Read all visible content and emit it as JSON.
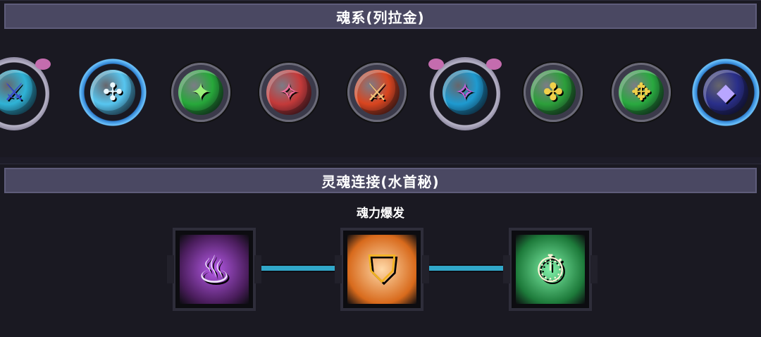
{
  "soul_section": {
    "title": "魂系(列拉金)",
    "items": [
      {
        "name": "soul-slot-1",
        "frame": "ornate",
        "orb_color": "#2fb3d6",
        "glyph": "⚔",
        "glyph_color": "#3a4ad0"
      },
      {
        "name": "soul-slot-2",
        "frame": "blue",
        "orb_color": "#57c6f0",
        "glyph": "✣",
        "glyph_color": "#eaf8ff"
      },
      {
        "name": "soul-slot-3",
        "frame": "plain",
        "orb_color": "#27a83a",
        "glyph": "✦",
        "glyph_color": "#9af07a"
      },
      {
        "name": "soul-slot-4",
        "frame": "plain",
        "orb_color": "#c43a3a",
        "glyph": "✧",
        "glyph_color": "#ff6fa3"
      },
      {
        "name": "soul-slot-5",
        "frame": "plain",
        "orb_color": "#d9451f",
        "glyph": "⚔",
        "glyph_color": "#f2c37a"
      },
      {
        "name": "soul-slot-6",
        "frame": "ornate",
        "orb_color": "#1e9ad0",
        "glyph": "✧",
        "glyph_color": "#d25ee0"
      },
      {
        "name": "soul-slot-7",
        "frame": "plain",
        "orb_color": "#2c9f3a",
        "glyph": "✤",
        "glyph_color": "#f0d04a"
      },
      {
        "name": "soul-slot-8",
        "frame": "plain",
        "orb_color": "#29a93f",
        "glyph": "✥",
        "glyph_color": "#f0d04a"
      },
      {
        "name": "soul-slot-9",
        "frame": "blue",
        "orb_color": "#2a2f8a",
        "glyph": "◆",
        "glyph_color": "#b8a6ff"
      }
    ]
  },
  "link_section": {
    "title": "灵魂连接(水首秘)",
    "skill_caption": "魂力爆发",
    "skills": [
      {
        "name": "skill-purple-flame",
        "bg": "#4a1d5c",
        "accent": "#b65ae8",
        "glyph": "♨",
        "glyph_color": "#f0e4ff"
      },
      {
        "name": "skill-shield",
        "bg": "#d86a1c",
        "accent": "#ffd9a8",
        "glyph": "⛉",
        "glyph_color": "#f2b320"
      },
      {
        "name": "skill-stopwatch",
        "bg": "#1d7a3a",
        "accent": "#7ff0a8",
        "glyph": "⏱",
        "glyph_color": "#fff4d8"
      }
    ],
    "connector_color": "#31a7c9"
  }
}
